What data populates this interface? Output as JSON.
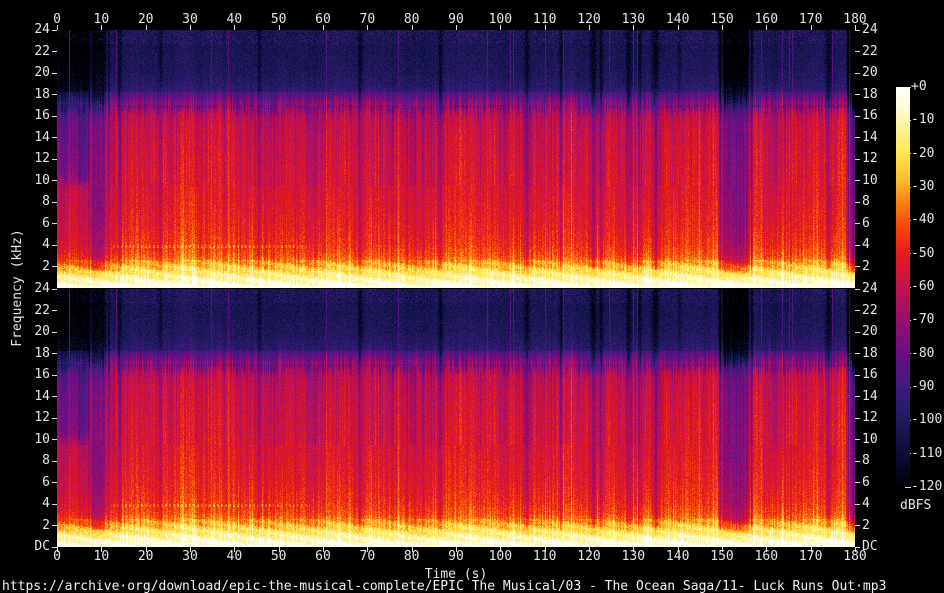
{
  "footer": {
    "url": "https://archive·org/download/epic-the-musical-complete/EPIC The Musical/03 - The Ocean Saga/11- Luck Runs Out·mp3"
  },
  "axes": {
    "time_label": "Time (s)",
    "freq_label": "Frequency (kHz)",
    "colorbar_label": "dBFS"
  },
  "chart_data": {
    "type": "heatmap",
    "subtype": "audio-spectrogram",
    "channels": [
      "left",
      "right"
    ],
    "x": {
      "label": "Time (s)",
      "unit": "s",
      "min": 0,
      "max": 180,
      "ticks": [
        0,
        10,
        20,
        30,
        40,
        50,
        60,
        70,
        80,
        90,
        100,
        110,
        120,
        130,
        140,
        150,
        160,
        170,
        180
      ]
    },
    "y": {
      "label": "Frequency (kHz)",
      "unit": "kHz",
      "min": 0,
      "max": 24,
      "ticks_khz": [
        24,
        22,
        20,
        18,
        16,
        14,
        12,
        10,
        8,
        6,
        4,
        2
      ],
      "dc_label": "DC"
    },
    "colorbar": {
      "label": "dBFS",
      "max": 0,
      "min": -120,
      "tick_labels": [
        "+0",
        "-10",
        "-20",
        "-30",
        "-40",
        "-50",
        "-60",
        "-70",
        "-80",
        "-90",
        "-100",
        "-110",
        "-120"
      ],
      "stops": [
        [
          0,
          "#ffffff"
        ],
        [
          -6,
          "#fefbd8"
        ],
        [
          -12,
          "#fdf39c"
        ],
        [
          -20,
          "#fde74f"
        ],
        [
          -28,
          "#fdbb30"
        ],
        [
          -35,
          "#fb7d12"
        ],
        [
          -42,
          "#f6470a"
        ],
        [
          -50,
          "#e51a1d"
        ],
        [
          -60,
          "#c3124f"
        ],
        [
          -70,
          "#970f6e"
        ],
        [
          -80,
          "#690d85"
        ],
        [
          -90,
          "#3f1a7c"
        ],
        [
          -100,
          "#1e1a5d"
        ],
        [
          -110,
          "#0b0d38"
        ],
        [
          -120,
          "#000002"
        ]
      ]
    },
    "content": {
      "seed": 1337,
      "noise_db": 11,
      "base_spectrum": [
        [
          0,
          -4
        ],
        [
          0.4,
          -9
        ],
        [
          1,
          -16
        ],
        [
          1.6,
          -24
        ],
        [
          2.2,
          -33
        ],
        [
          3,
          -42
        ],
        [
          4,
          -47
        ],
        [
          6,
          -51
        ],
        [
          9,
          -54
        ],
        [
          12,
          -56
        ],
        [
          15,
          -59
        ],
        [
          16.2,
          -63
        ],
        [
          16.9,
          -76
        ],
        [
          17.6,
          -88
        ],
        [
          18.4,
          -96
        ],
        [
          20,
          -101
        ],
        [
          22,
          -103
        ],
        [
          24,
          -104
        ]
      ],
      "segments": [
        {
          "t0": 0,
          "t1": 7.3,
          "gain": -5
        },
        {
          "t0": 7.3,
          "t1": 11.3,
          "gain": -14
        },
        {
          "t0": 11.3,
          "t1": 149.6,
          "gain": 0
        },
        {
          "t0": 149.6,
          "t1": 156.4,
          "gain": -21
        },
        {
          "t0": 156.4,
          "t1": 178.6,
          "gain": 0
        },
        {
          "t0": 178.6,
          "t1": 180,
          "gain": -34
        }
      ],
      "dips": [
        [
          14.0,
          0.5,
          -10
        ],
        [
          23.3,
          0.4,
          -9
        ],
        [
          45.6,
          0.5,
          -9
        ],
        [
          68.3,
          0.6,
          -10
        ],
        [
          86.4,
          0.5,
          -12
        ],
        [
          105.9,
          0.5,
          -11
        ],
        [
          113.6,
          0.5,
          -10
        ],
        [
          120.9,
          0.8,
          -14
        ],
        [
          122.6,
          0.5,
          -12
        ],
        [
          128.9,
          0.7,
          -12
        ],
        [
          131.4,
          0.5,
          -10
        ],
        [
          134.9,
          0.8,
          -13
        ],
        [
          140.3,
          0.5,
          -9
        ],
        [
          173.9,
          0.9,
          -13
        ]
      ],
      "intro": {
        "t1": 7.3,
        "hf_from": 9.0,
        "hf_gain": -13
      },
      "transients": {
        "t0": 94,
        "t1": 121,
        "prob": 0.1,
        "base_prob": 0.035
      },
      "hf_band_khz": [
        17.0,
        18.2
      ],
      "content_cutoff_khz": 16.5,
      "dotted_line": {
        "khz": 3.85,
        "t0": 12,
        "t1": 57
      }
    }
  }
}
